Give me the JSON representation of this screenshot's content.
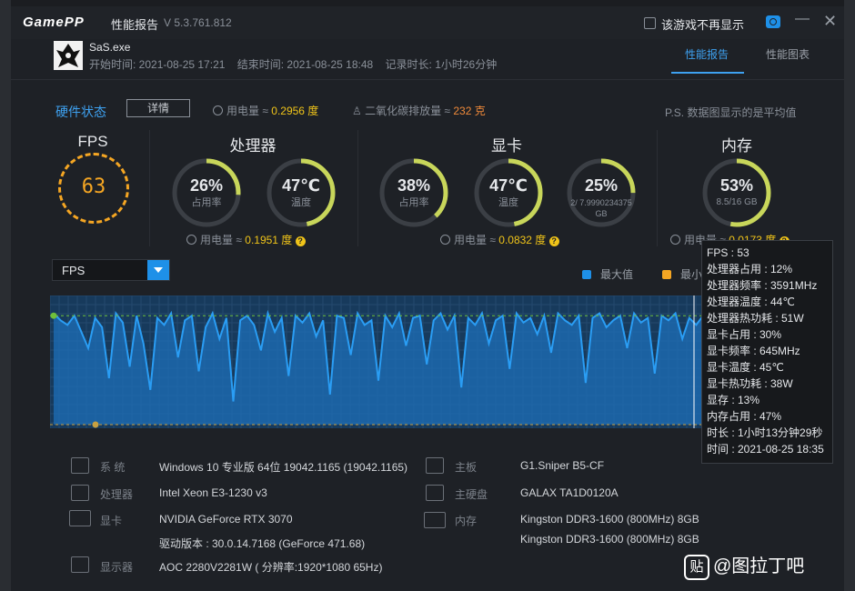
{
  "app": {
    "logo": "GamePP",
    "title": "性能报告",
    "version": "V 5.3.761.812",
    "hide_checkbox_label": "该游戏不再显示"
  },
  "game": {
    "name": "SaS.exe",
    "start_label": "开始时间: 2021-08-25 17:21",
    "end_label": "结束时间: 2021-08-25 18:48",
    "duration_label": "记录时长: 1小时26分钟"
  },
  "tabs": [
    "性能报告",
    "性能图表"
  ],
  "hw_status": {
    "title": "硬件状态",
    "details_button": "详情",
    "power_text": "用电量 ≈ ",
    "power_value": "0.2956 度",
    "co2_text": "二氧化碳排放量 ≈ ",
    "co2_value": "232 克",
    "note": "P.S. 数据图显示的是平均值"
  },
  "fps": {
    "title": "FPS",
    "value": "63"
  },
  "cpu": {
    "title": "处理器",
    "usage": {
      "value": "26%",
      "label": "占用率",
      "fraction": 0.26
    },
    "temp": {
      "value": "47℃",
      "label": "温度",
      "fraction": 0.47
    },
    "power_text": "用电量 ≈ ",
    "power_value": "0.1951 度"
  },
  "gpu": {
    "title": "显卡",
    "usage": {
      "value": "38%",
      "label": "占用率",
      "fraction": 0.38
    },
    "temp": {
      "value": "47℃",
      "label": "温度",
      "fraction": 0.47
    },
    "vram": {
      "value": "25%",
      "label": "2/ 7.9990234375 GB",
      "fraction": 0.25
    },
    "power_text": "用电量 ≈ ",
    "power_value": "0.0832 度"
  },
  "memory": {
    "title": "内存",
    "usage": {
      "value": "53%",
      "label": "8.5/16 GB",
      "fraction": 0.53
    },
    "power_text": "用电量 ≈ ",
    "power_value": "0.0173 度"
  },
  "chart_controls": {
    "metric_select": "FPS",
    "legend_max": "最大值",
    "legend_min": "最小"
  },
  "chart_data": {
    "type": "area",
    "series": [
      {
        "name": "FPS",
        "values": [
          63,
          60,
          58,
          62,
          55,
          48,
          61,
          57,
          35,
          63,
          59,
          40,
          62,
          50,
          30,
          61,
          58,
          63,
          44,
          60,
          62,
          38,
          57,
          63,
          52,
          61,
          25,
          60,
          62,
          58,
          47,
          63,
          55,
          61,
          36,
          62,
          59,
          63,
          53,
          60,
          28,
          62,
          61,
          45,
          63,
          58,
          60,
          34,
          62,
          57,
          63,
          49,
          61,
          62,
          41,
          60,
          63,
          56,
          62,
          31,
          61,
          58,
          63,
          50,
          60,
          62,
          39,
          63,
          59,
          61,
          54,
          62,
          46,
          63,
          60,
          58,
          62,
          33,
          61,
          63,
          57,
          60,
          62,
          48,
          63,
          59,
          61,
          37,
          62,
          60,
          63,
          52,
          61,
          58,
          62,
          43,
          63,
          60,
          61,
          55
        ]
      }
    ],
    "markers": {
      "max": 63,
      "min": 20
    },
    "grid": true
  },
  "tooltip": [
    "FPS : 53",
    "处理器占用 : 12%",
    "处理器频率 : 3591MHz",
    "处理器温度 : 44℃",
    "处理器热功耗 : 51W",
    "显卡占用 : 30%",
    "显卡频率 : 645MHz",
    "显卡温度 : 45℃",
    "显卡热功耗 : 38W",
    "显存 : 13%",
    "内存占用 : 47%",
    "时长 : 1小时13分钟29秒",
    "时间 : 2021-08-25 18:35"
  ],
  "hardware": {
    "system_label": "系  统",
    "system_value": "Windows 10 专业版 64位   19042.1165 (19042.1165)",
    "cpu_label": "处理器",
    "cpu_value": "Intel Xeon E3-1230 v3",
    "gpu_label": "显卡",
    "gpu_value": "NVIDIA GeForce RTX 3070",
    "driver_value": "驱动版本 : 30.0.14.7168 (GeForce 471.68)",
    "monitor_label": "显示器",
    "monitor_value": "AOC 2280V2281W ( 分辨率:1920*1080 65Hz)",
    "board_label": "主板",
    "board_value": "G1.Sniper B5-CF",
    "disk_label": "主硬盘",
    "disk_value": "GALAX TA1D0120A",
    "mem_label": "内存",
    "mem_value1": "Kingston DDR3-1600 (800MHz) 8GB",
    "mem_value2": "Kingston DDR3-1600 (800MHz) 8GB"
  },
  "watermark": {
    "icon": "贴",
    "text": "@图拉丁吧"
  },
  "colors": {
    "accent": "#3ea1f0",
    "fps": "#f5a623",
    "gauge": "#c8d65a",
    "chart": "#1e8fe0"
  }
}
